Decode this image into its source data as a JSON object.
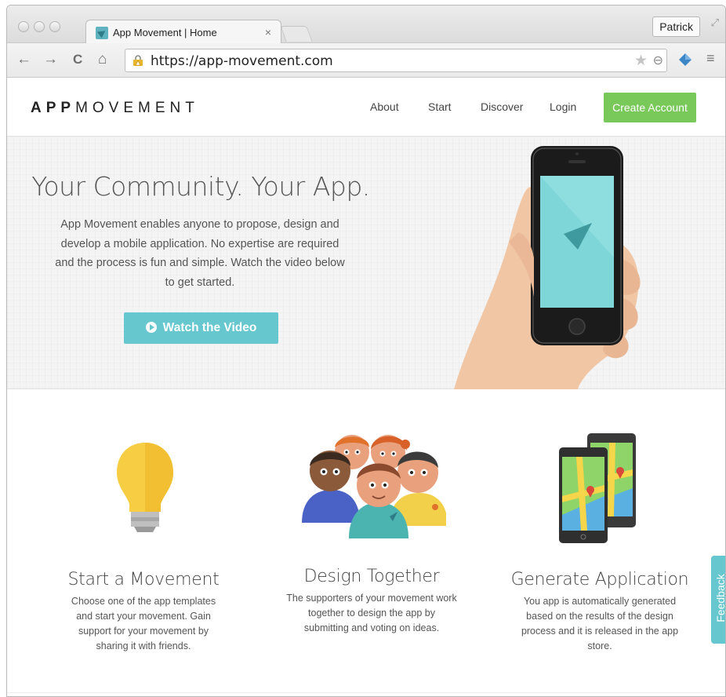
{
  "browser": {
    "tab_title": "App Movement | Home",
    "tab_close": "×",
    "profile_name": "Patrick",
    "url": "https://app-movement.com",
    "nav": {
      "back": "←",
      "forward": "→",
      "reload": "C",
      "home": "⌂"
    },
    "star": "★",
    "zoom": "⊖",
    "menu": "≡"
  },
  "site": {
    "logo_bold": "APP",
    "logo_light": "MOVEMENT",
    "nav": [
      "About",
      "Start",
      "Discover",
      "Login"
    ],
    "cta": "Create Account"
  },
  "hero": {
    "title": "Your Community. Your App.",
    "text": "App Movement enables anyone to propose, design and develop a mobile application. No expertise are required and the process is fun and simple. Watch the video below to get started.",
    "button": "Watch the Video"
  },
  "features": [
    {
      "title": "Start a Movement",
      "text": "Choose one of the app templates and start your movement. Gain support for your movement by sharing it with friends.",
      "icon": "lightbulb-icon"
    },
    {
      "title": "Design Together",
      "text": "The supporters of your movement work together to design the app by submitting and voting on ideas.",
      "icon": "people-group-icon"
    },
    {
      "title": "Generate Application",
      "text": "You app is automatically generated based on the results of the design process and it is released in the app store.",
      "icon": "phones-map-icon"
    }
  ],
  "feedback": "Feedback",
  "colors": {
    "accent": "#67c7cf",
    "cta": "#79c85a"
  }
}
